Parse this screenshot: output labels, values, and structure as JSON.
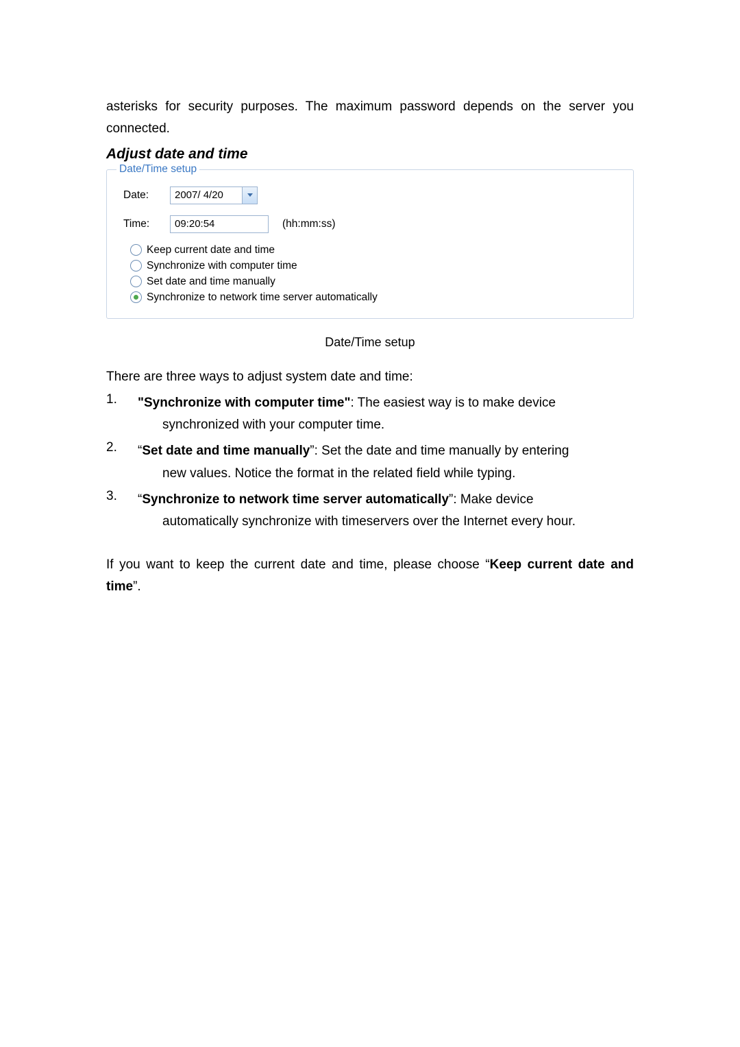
{
  "intro_text": "asterisks for security purposes. The maximum password depends on the server you connected.",
  "section_heading": "Adjust date and time",
  "fieldset": {
    "legend": "Date/Time setup",
    "date_label": "Date:",
    "date_value": "2007/ 4/20",
    "time_label": "Time:",
    "time_value": "09:20:54",
    "time_hint": "(hh:mm:ss)",
    "radios": {
      "r1": "Keep current date and time",
      "r2": "Synchronize with computer time",
      "r3": "Set date and time manually",
      "r4": "Synchronize to network time server automatically"
    }
  },
  "caption": "Date/Time setup",
  "list_intro": "There are three ways to adjust system date and time:",
  "items": {
    "n1": "1.",
    "n2": "2.",
    "n3": "3.",
    "i1_bold": "\"Synchronize with computer time\"",
    "i1_rest": ": The easiest way is to make device",
    "i1_line2": "synchronized with your computer time.",
    "i2_pre": "“",
    "i2_bold": "Set date and time manually",
    "i2_rest": "”: Set the date and time manually by entering",
    "i2_line2": "new values. Notice the format in the related field while typing.",
    "i3_pre": "“",
    "i3_bold": "Synchronize to network time server automatically",
    "i3_rest": "”: Make device",
    "i3_line2": "automatically synchronize with timeservers over the Internet every hour."
  },
  "closing_pre": "If you want to keep the current date and time, please choose “",
  "closing_bold": "Keep current date and time",
  "closing_post": "”."
}
